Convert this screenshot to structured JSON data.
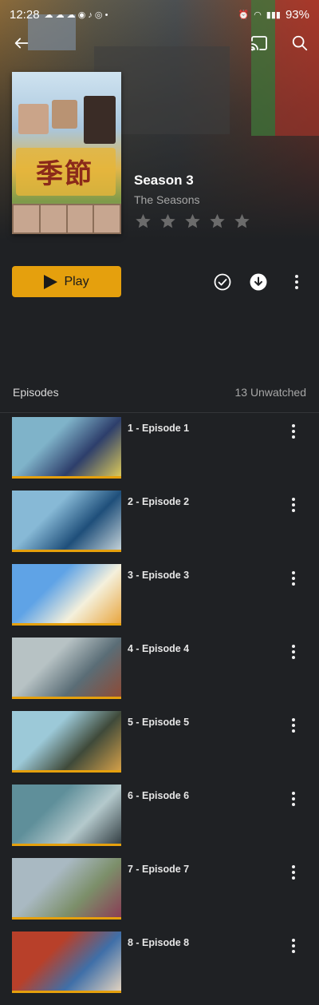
{
  "status_bar": {
    "time": "12:28",
    "battery": "93%"
  },
  "header": {
    "back_label": "Back",
    "cast_label": "Cast",
    "search_label": "Search"
  },
  "poster": {
    "title": "季節"
  },
  "season": {
    "title": "Season 3",
    "show_name": "The Seasons",
    "rating_stars": 0,
    "rating_max": 5
  },
  "actions": {
    "play_label": "Play"
  },
  "episodes_section": {
    "label": "Episodes",
    "unwatched": "13 Unwatched"
  },
  "episodes": [
    {
      "title": "1 - Episode 1",
      "thumb_colors": [
        "#7fb3c9",
        "#2d3e6b",
        "#e2cf5a"
      ]
    },
    {
      "title": "2 - Episode 2",
      "thumb_colors": [
        "#87b9d6",
        "#1f4f7a",
        "#c9d6db"
      ]
    },
    {
      "title": "3 - Episode 3",
      "thumb_colors": [
        "#5fa3e6",
        "#f4f0dc",
        "#e8a33a"
      ]
    },
    {
      "title": "4 - Episode 4",
      "thumb_colors": [
        "#b7c2c4",
        "#5a6d76",
        "#8f4a35"
      ]
    },
    {
      "title": "5 - Episode 5",
      "thumb_colors": [
        "#9cc9d8",
        "#3f4a3a",
        "#d9a34a"
      ]
    },
    {
      "title": "6 - Episode 6",
      "thumb_colors": [
        "#5f8f9a",
        "#b4c9cc",
        "#2f3a3f"
      ]
    },
    {
      "title": "7 - Episode 7",
      "thumb_colors": [
        "#a9b9c2",
        "#7c8f6a",
        "#8a3a55"
      ]
    },
    {
      "title": "8 - Episode 8",
      "thumb_colors": [
        "#b8402a",
        "#3f6fa8",
        "#e8d6c0"
      ]
    }
  ],
  "colors": {
    "accent": "#e5a00d",
    "background": "#1f2124"
  }
}
